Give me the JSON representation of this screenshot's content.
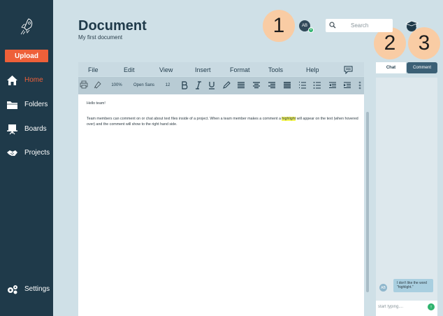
{
  "sidebar": {
    "upload_label": "Upload",
    "items": [
      {
        "label": "Home",
        "icon": "home-icon",
        "active": true
      },
      {
        "label": "Folders",
        "icon": "folder-icon",
        "active": false
      },
      {
        "label": "Boards",
        "icon": "board-icon",
        "active": false
      },
      {
        "label": "Projects",
        "icon": "handshake-icon",
        "active": false
      }
    ],
    "settings_label": "Settings"
  },
  "header": {
    "title": "Document",
    "subtitle": "My first document",
    "avatar_initials": "AB",
    "avatar_badge": "+",
    "search_placeholder": "Search"
  },
  "annotations": [
    "1",
    "2",
    "3"
  ],
  "menu": [
    "File",
    "Edit",
    "View",
    "Insert",
    "Format",
    "Tools",
    "Help"
  ],
  "toolbar": {
    "zoom": "100%",
    "font": "Open Sans",
    "font_size": "12"
  },
  "editor": {
    "greeting": "Hello team!",
    "body_before": "Team members can comment on or chat about text files inside of a project. When a team member makes a comment a ",
    "body_highlight": "highlight",
    "body_after": " will appear on the text (when hovered over) and the comment will show to the right hand side."
  },
  "panel": {
    "tab_chat": "Chat",
    "tab_comment": "Comment",
    "comment_avatar": "AB",
    "comment_text": "I don't like the word \"highlight.\"",
    "compose_placeholder": "start typing....",
    "send_icon": "↑"
  },
  "colors": {
    "sidebar": "#1f3a4a",
    "accent": "#ee6039",
    "background": "#cfe0e7",
    "annotation": "#f9cca4",
    "highlight": "#f3f55a"
  }
}
